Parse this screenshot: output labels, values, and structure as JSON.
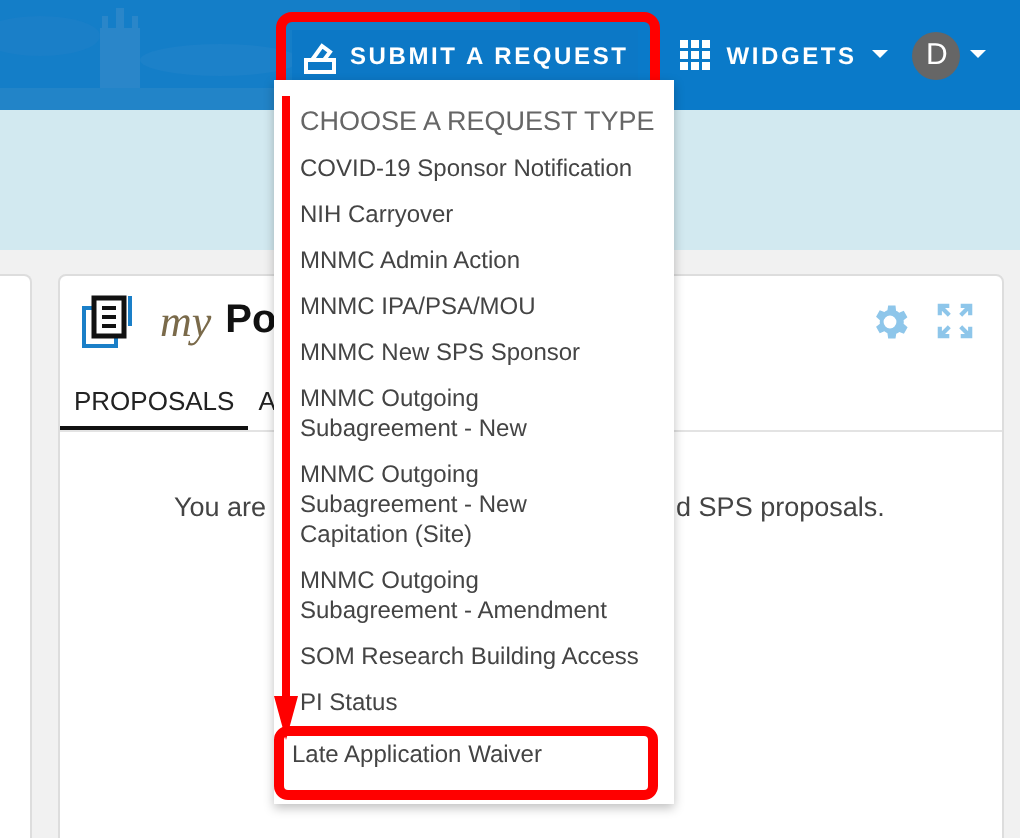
{
  "header": {
    "submit_button": {
      "label": "SUBMIT A REQUEST",
      "highlighted": true
    },
    "widgets_menu": {
      "label": "WIDGETS"
    },
    "avatar": "D"
  },
  "dropdown": {
    "heading": "CHOOSE A REQUEST TYPE",
    "items": [
      {
        "label": "COVID-19 Sponsor Notification",
        "highlighted": false
      },
      {
        "label": "NIH Carryover",
        "highlighted": false
      },
      {
        "label": "MNMC Admin Action",
        "highlighted": false
      },
      {
        "label": "MNMC IPA/PSA/MOU",
        "highlighted": false
      },
      {
        "label": "MNMC New SPS Sponsor",
        "highlighted": false
      },
      {
        "label": "MNMC Outgoing\nSubagreement - New",
        "highlighted": false
      },
      {
        "label": "MNMC Outgoing\nSubagreement - New\nCapitation (Site)",
        "highlighted": false
      },
      {
        "label": "MNMC Outgoing\nSubagreement - Amendment",
        "highlighted": false
      },
      {
        "label": "SOM Research Building Access",
        "highlighted": false
      },
      {
        "label": "PI Status",
        "highlighted": false
      },
      {
        "label": "Late Application Waiver",
        "highlighted": true
      }
    ]
  },
  "card": {
    "title_prefix": "my",
    "title": "Po",
    "tabs": [
      {
        "label": "PROPOSALS",
        "selected": true
      },
      {
        "label": "A",
        "selected": false
      }
    ],
    "message_parts": [
      "You are",
      "d SPS proposals."
    ]
  }
}
